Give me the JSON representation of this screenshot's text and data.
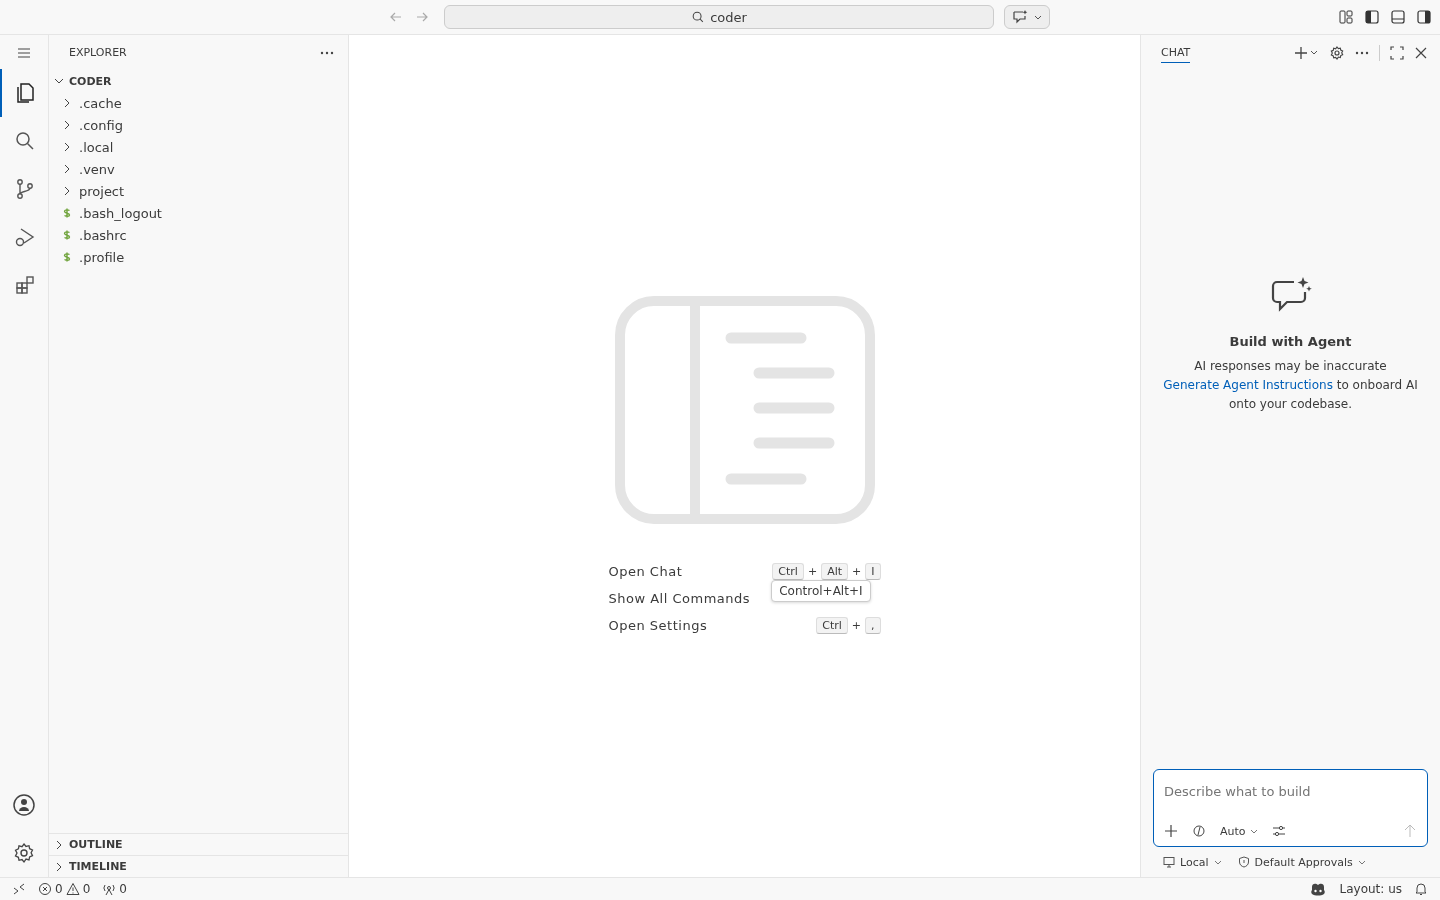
{
  "title_bar": {
    "search": "coder"
  },
  "activity_bar": [
    {
      "kind": "files",
      "selected": true
    },
    {
      "kind": "search",
      "selected": false
    },
    {
      "kind": "source-control",
      "selected": false
    },
    {
      "kind": "run-debug",
      "selected": false
    },
    {
      "kind": "extensions",
      "selected": false
    }
  ],
  "sidebar": {
    "title": "EXPLORER",
    "folder": {
      "name": "CODER",
      "expanded": true,
      "children": [
        {
          "name": ".cache",
          "kind": "folder"
        },
        {
          "name": ".config",
          "kind": "folder"
        },
        {
          "name": ".local",
          "kind": "folder"
        },
        {
          "name": ".venv",
          "kind": "folder"
        },
        {
          "name": "project",
          "kind": "folder"
        },
        {
          "name": ".bash_logout",
          "kind": "shell"
        },
        {
          "name": ".bashrc",
          "kind": "shell"
        },
        {
          "name": ".profile",
          "kind": "shell"
        }
      ]
    },
    "sections": [
      {
        "name": "OUTLINE",
        "expanded": false
      },
      {
        "name": "TIMELINE",
        "expanded": false
      }
    ]
  },
  "editor": {
    "shortcuts": [
      {
        "label": "Open Chat",
        "keys": [
          "Ctrl",
          "Alt",
          "I"
        ],
        "joiner": "+",
        "tooltip": "Control+Alt+I"
      },
      {
        "label": "Show All Commands"
      },
      {
        "label": "Open Settings",
        "keys": [
          "Ctrl",
          ","
        ],
        "joiner": "+"
      }
    ]
  },
  "chat": {
    "tab": "CHAT",
    "heading": "Build with Agent",
    "note": "AI responses may be inaccurate",
    "link": "Generate Agent Instructions",
    "link_rest": " to onboard AI onto your codebase.",
    "input": {
      "placeholder": "Describe what to build",
      "mode": "Auto"
    },
    "target": "Local",
    "approvals": "Default Approvals"
  },
  "status_bar": {
    "errors": "0",
    "warnings": "0",
    "ports": "0",
    "layout": "Layout: us"
  }
}
